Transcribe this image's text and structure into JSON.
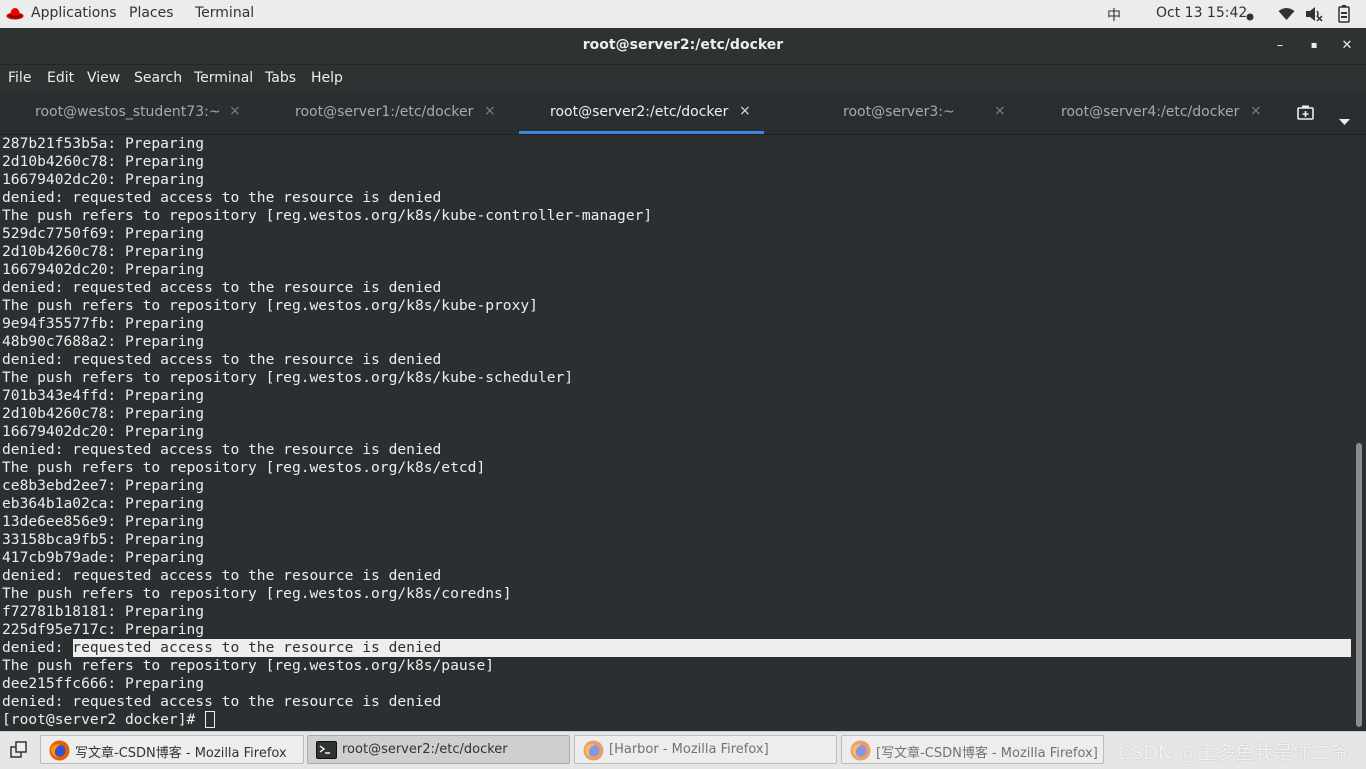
{
  "topbar": {
    "applications": "Applications",
    "places": "Places",
    "terminal": "Terminal",
    "input_method": "中",
    "datetime": "Oct 13  15:42",
    "icons": [
      "redhat-icon",
      "wifi-icon",
      "volume-icon",
      "battery-icon"
    ]
  },
  "window": {
    "title": "root@server2:/etc/docker",
    "minimize": "–",
    "maximize": "▪",
    "close": "✕"
  },
  "menubar": [
    "File",
    "Edit",
    "View",
    "Search",
    "Terminal",
    "Tabs",
    "Help"
  ],
  "tabs": [
    {
      "label": "root@westos_student73:~",
      "active": false
    },
    {
      "label": "root@server1:/etc/docker",
      "active": false
    },
    {
      "label": "root@server2:/etc/docker",
      "active": true
    },
    {
      "label": "root@server3:~",
      "active": false
    },
    {
      "label": "root@server4:/etc/docker",
      "active": false
    }
  ],
  "tab_close": "×",
  "terminal_lines": [
    "287b21f53b5a: Preparing",
    "2d10b4260c78: Preparing",
    "16679402dc20: Preparing",
    "denied: requested access to the resource is denied",
    "The push refers to repository [reg.westos.org/k8s/kube-controller-manager]",
    "529dc7750f69: Preparing",
    "2d10b4260c78: Preparing",
    "16679402dc20: Preparing",
    "denied: requested access to the resource is denied",
    "The push refers to repository [reg.westos.org/k8s/kube-proxy]",
    "9e94f35577fb: Preparing",
    "48b90c7688a2: Preparing",
    "denied: requested access to the resource is denied",
    "The push refers to repository [reg.westos.org/k8s/kube-scheduler]",
    "701b343e4ffd: Preparing",
    "2d10b4260c78: Preparing",
    "16679402dc20: Preparing",
    "denied: requested access to the resource is denied",
    "The push refers to repository [reg.westos.org/k8s/etcd]",
    "ce8b3ebd2ee7: Preparing",
    "eb364b1a02ca: Preparing",
    "13de6ee856e9: Preparing",
    "33158bca9fb5: Preparing",
    "417cb9b79ade: Preparing",
    "denied: requested access to the resource is denied",
    "The push refers to repository [reg.westos.org/k8s/coredns]",
    "f72781b18181: Preparing",
    "225df95e717c: Preparing",
    "denied: requested access to the resource is denied",
    "The push refers to repository [reg.westos.org/k8s/pause]",
    "dee215ffc666: Preparing",
    "denied: requested access to the resource is denied",
    "[root@server2 docker]# "
  ],
  "taskbar": {
    "items": [
      {
        "label": "写文章-CSDN博客 - Mozilla Firefox",
        "icon": "firefox-icon",
        "active": false,
        "dim": false
      },
      {
        "label": "root@server2:/etc/docker",
        "icon": "terminal-icon",
        "active": true,
        "dim": false
      },
      {
        "label": "[Harbor - Mozilla Firefox]",
        "icon": "firefox-icon",
        "active": false,
        "dim": true
      },
      {
        "label": "[写文章-CSDN博客 - Mozilla Firefox]",
        "icon": "firefox-icon",
        "active": false,
        "dim": true
      }
    ],
    "watermark": "CSDN @王多鱼我是你二爷"
  },
  "colors": {
    "terminal_bg": "#2b2f31",
    "terminal_fg": "#eeeeec",
    "tab_accent": "#3c86e0",
    "panel_bg": "#ececec"
  }
}
